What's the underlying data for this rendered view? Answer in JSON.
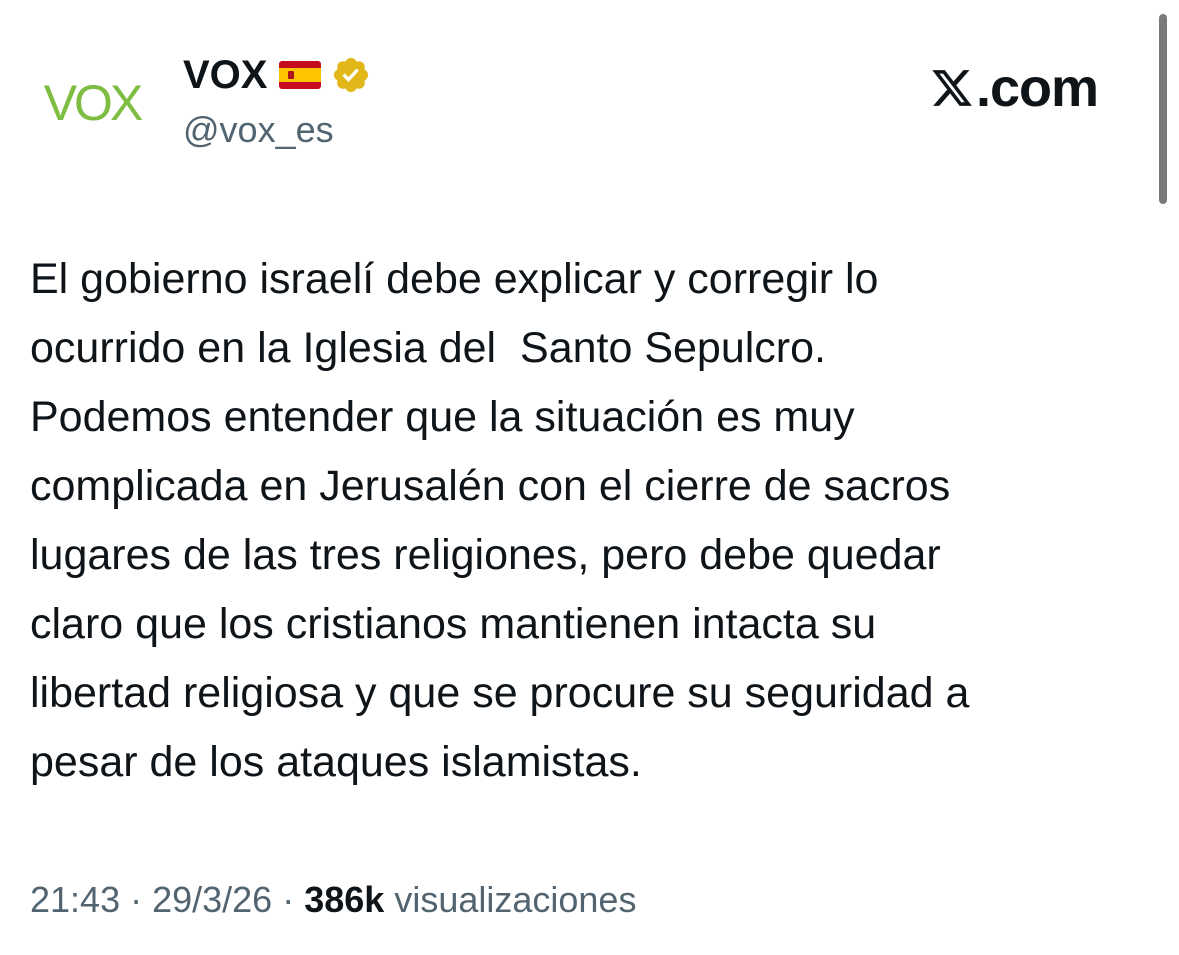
{
  "author": {
    "avatar_text": "VOX",
    "display_name": "VOX",
    "handle": "@vox_es",
    "flag_icon": "spain-flag-icon",
    "verified_icon": "gold-verified-badge-icon"
  },
  "brand": {
    "icon": "x-logo-icon",
    "text": ".com"
  },
  "tweet": {
    "text": "El gobierno israelí debe explicar y corregir lo\nocurrido en la Iglesia del  Santo Sepulcro.\nPodemos entender que la situación es muy\ncomplicada en Jerusalén con el cierre de sacros\nlugares de las tres religiones, pero debe quedar\nclaro que los cristianos mantienen intacta su\nlibertad religiosa y que se procure su seguridad a\npesar de los ataques islamistas."
  },
  "meta": {
    "time": "21:43",
    "separator": "·",
    "date": "29/3/26",
    "views_count": "386k",
    "views_label": "visualizaciones"
  },
  "colors": {
    "avatar_green": "#7cbd42",
    "text_primary": "#0f1419",
    "text_secondary": "#536471",
    "verified_gold": "#e2b719",
    "flag_red": "#c60b1e",
    "flag_yellow": "#ffc400"
  }
}
